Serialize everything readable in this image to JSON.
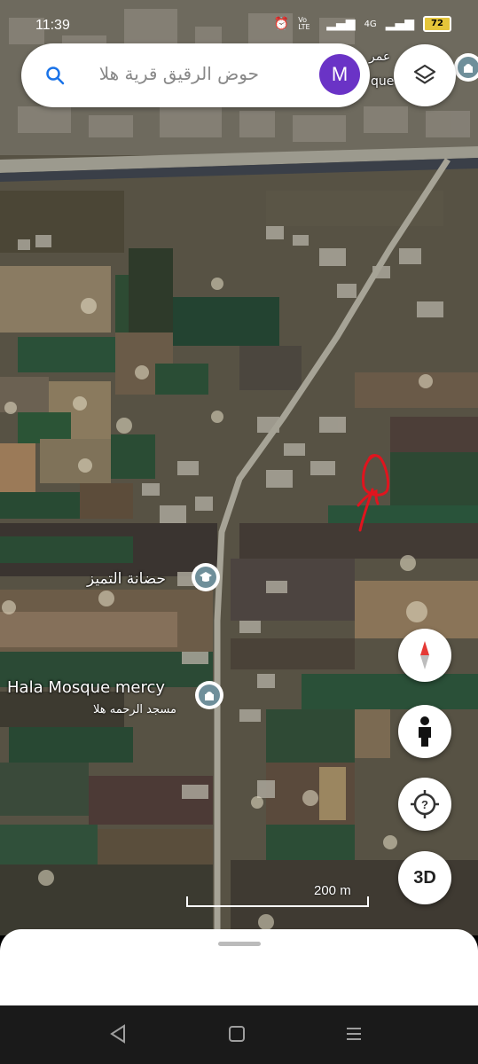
{
  "status_bar": {
    "time": "11:39",
    "network_label": "4G",
    "volte_label": "Vo LTE",
    "battery": "72"
  },
  "search": {
    "query": "حوض الرقيق قرية هلا",
    "avatar_letter": "M",
    "icon": "search-icon"
  },
  "map_labels": {
    "top_right_label_1": "عمر",
    "top_right_label_2": "que",
    "nursery_name": "حضانة التميز",
    "mosque_name": "Hala Mosque mercy",
    "mosque_arabic": "مسجد الرحمه هلا"
  },
  "controls": {
    "layers_icon": "layers-icon",
    "compass_icon": "compass-icon",
    "street_view_icon": "pegman-icon",
    "locate_icon": "my-location-icon",
    "three_d_label": "3D"
  },
  "scale": {
    "label": "200 m"
  },
  "nav": {
    "back": "back-icon",
    "home": "home-icon",
    "recents": "recents-icon"
  },
  "colors": {
    "accent_avatar": "#6a33c6",
    "poi_icon": "#6f8f9a",
    "annotation_red": "#e0141e"
  }
}
